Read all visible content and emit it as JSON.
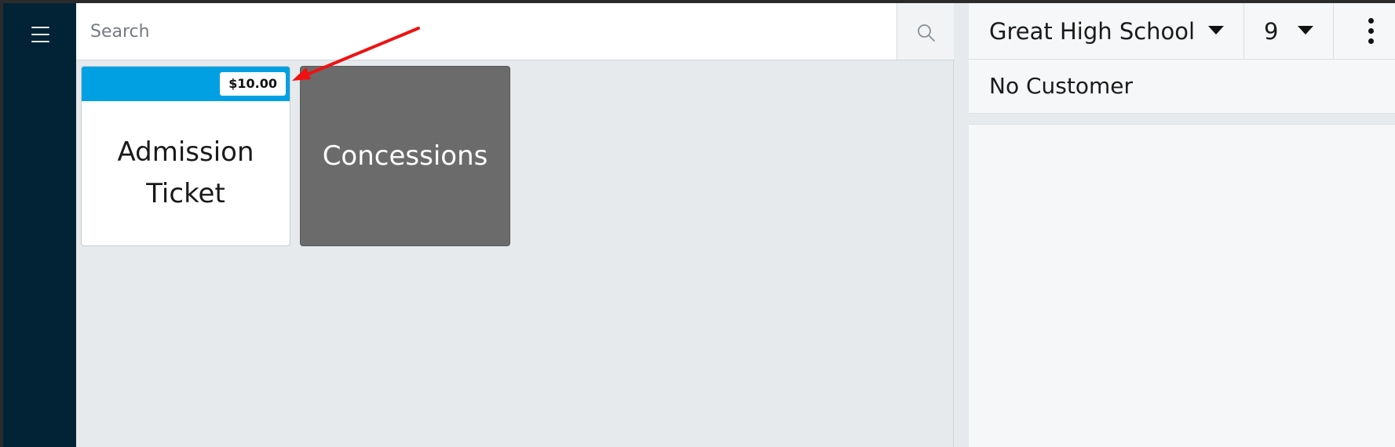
{
  "search": {
    "placeholder": "Search",
    "value": ""
  },
  "tiles": [
    {
      "title": "Admission Ticket",
      "price": "$10.00",
      "header_color": "#00a0e3"
    },
    {
      "title": "Concessions",
      "background_color": "#6b6b6b"
    }
  ],
  "order_panel": {
    "venue": "Great High School",
    "quantity": "9",
    "customer": "No Customer"
  },
  "colors": {
    "nav_rail": "#022335",
    "accent": "#00a0e3",
    "annotation_arrow": "#f01111"
  },
  "icons": {
    "menu": "hamburger-icon",
    "search": "search-icon",
    "dropdown": "caret-down-icon",
    "more": "more-vertical-icon"
  }
}
